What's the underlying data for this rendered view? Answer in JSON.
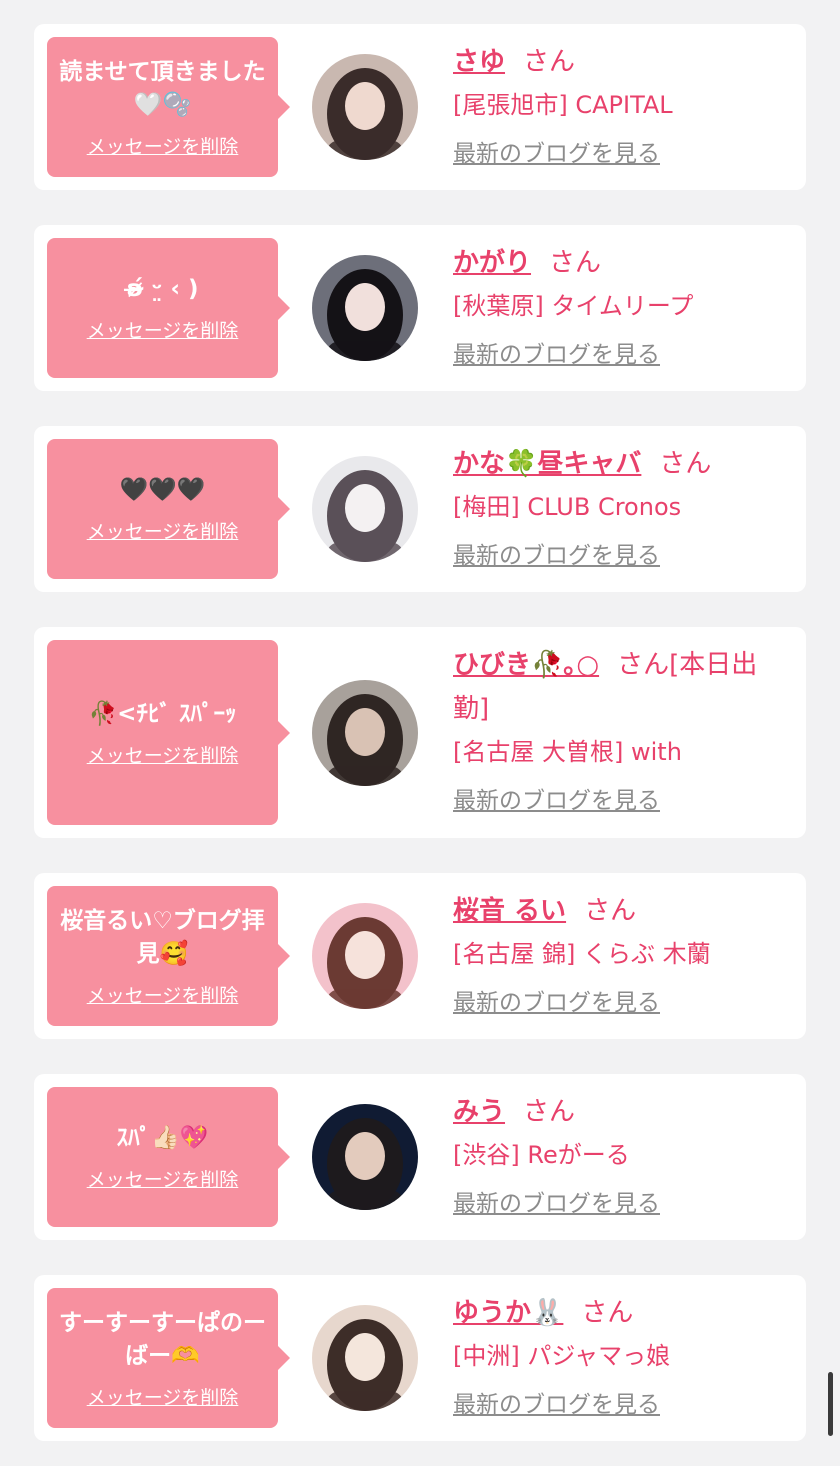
{
  "delete_label": "メッセージを削除",
  "blog_label": "最新のブログを見る",
  "honorific": "さん",
  "colors": {
    "accent": "#e8416b",
    "bubble": "#f7909f",
    "link_gray": "#8c8c8c",
    "background": "#f2f2f3"
  },
  "entries": [
    {
      "message": "読ませて頂きました🤍🫧",
      "name": "さゆ",
      "suffix": "",
      "shop": "[尾張旭市] CAPITAL"
    },
    {
      "message": "ʚ̴̶̷́ ᵕ̤ ‹ )",
      "name": "かがり",
      "suffix": "",
      "shop": "[秋葉原] タイムリープ"
    },
    {
      "message": "🖤🖤🖤",
      "name": "かな🍀昼キャバ",
      "suffix": "",
      "shop": "[梅田] CLUB Cronos"
    },
    {
      "message": "🥀<ﾁﾋﾞ ｽﾊﾟｰｯ",
      "name": "ひびき🥀｡○",
      "suffix": "[本日出勤]",
      "shop": "[名古屋 大曽根] with"
    },
    {
      "message": "桜音るい♡ブログ拝見🥰",
      "name": "桜音 るい",
      "suffix": "",
      "shop": "[名古屋 錦] くらぶ 木蘭"
    },
    {
      "message": "ｽﾊﾟ👍🏻💖",
      "name": "みう",
      "suffix": "",
      "shop": "[渋谷] Reがーる"
    },
    {
      "message": "すーすーすーぱのーばー🫶",
      "name": "ゆうか🐰",
      "suffix": "",
      "shop": "[中洲] パジャマっ娘"
    }
  ]
}
